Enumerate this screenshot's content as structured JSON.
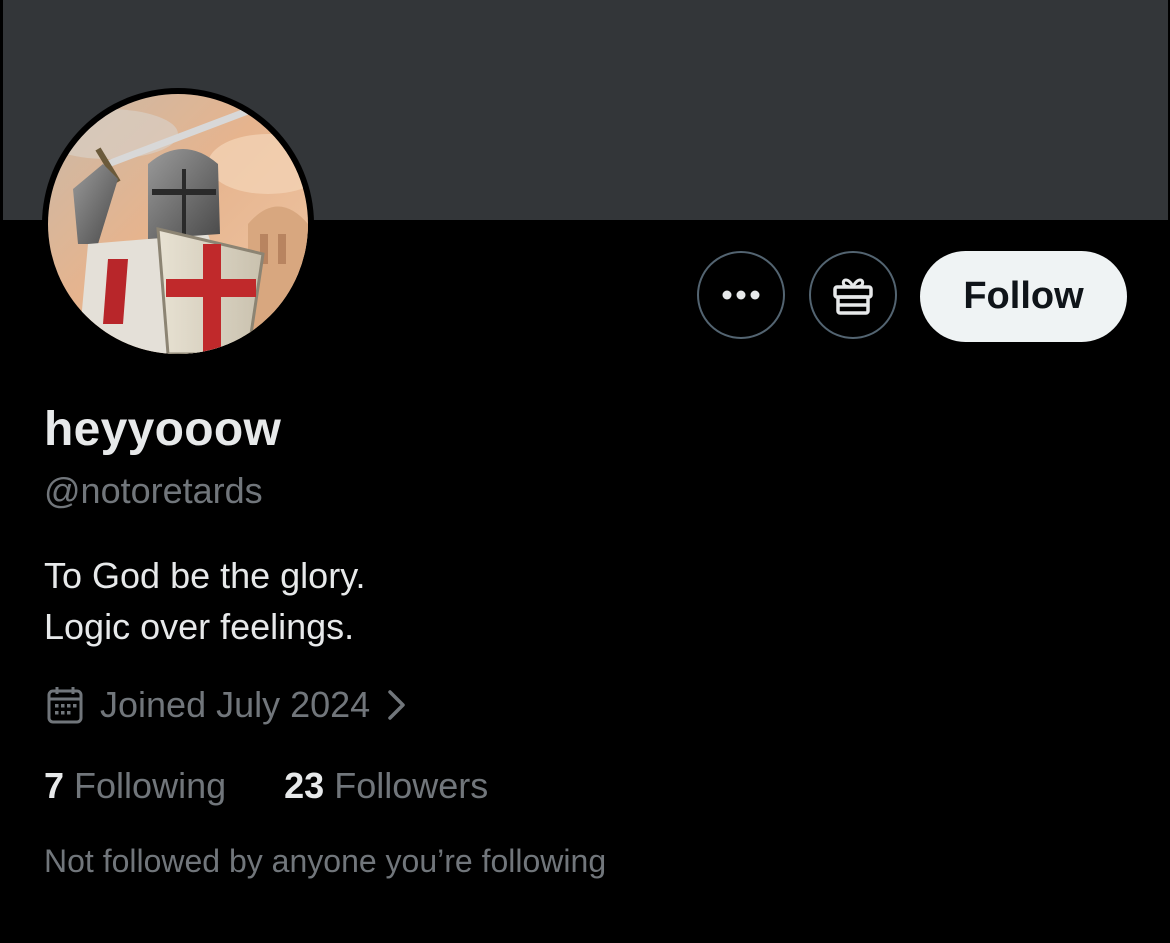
{
  "profile": {
    "display_name": "heyyooow",
    "handle": "@notoretards",
    "bio_lines": [
      "To God be the glory.",
      "Logic over feelings."
    ],
    "joined": "Joined July 2024",
    "following_count": "7",
    "following_label": "Following",
    "followers_count": "23",
    "followers_label": "Followers",
    "mutuals_note": "Not followed by anyone you’re following"
  },
  "actions": {
    "more_icon": "more-horizontal-icon",
    "gift_icon": "gift-icon",
    "follow_label": "Follow"
  },
  "colors": {
    "background": "#000000",
    "banner": "#333639",
    "primary_text": "#e7e9ea",
    "secondary_text": "#71767b",
    "button_border": "#536471",
    "follow_bg": "#eff3f4",
    "follow_text": "#0f1419"
  }
}
